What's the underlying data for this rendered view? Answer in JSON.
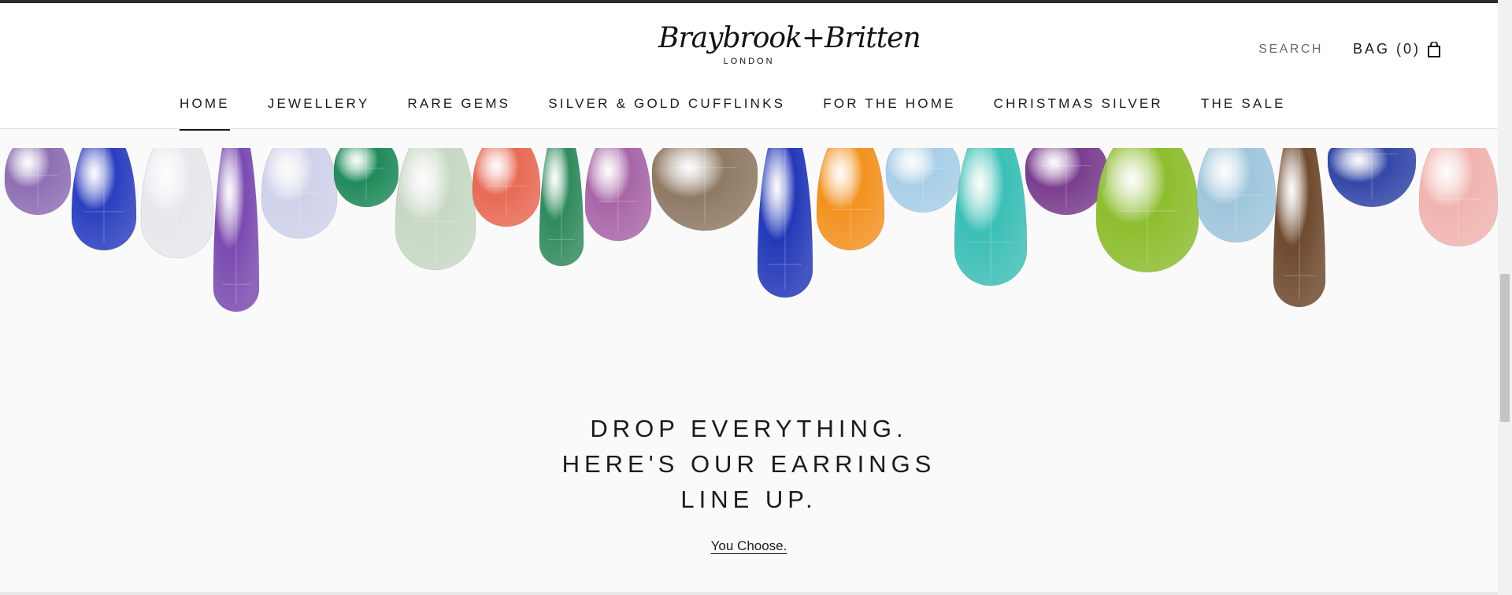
{
  "brand": {
    "logo_script": "Braybrook+Britten",
    "logo_sub": "LONDON"
  },
  "header": {
    "search_label": "SEARCH",
    "bag_label": "BAG (0)",
    "bag_icon": "shopping-bag-icon"
  },
  "nav": {
    "items": [
      {
        "label": "HOME",
        "active": true
      },
      {
        "label": "JEWELLERY"
      },
      {
        "label": "RARE GEMS"
      },
      {
        "label": "SILVER & GOLD CUFFLINKS"
      },
      {
        "label": "FOR THE HOME"
      },
      {
        "label": "CHRISTMAS SILVER"
      },
      {
        "label": "THE SALE"
      }
    ]
  },
  "hero": {
    "gem_colors": [
      "#8e6fb4",
      "#2a3fbf",
      "#e6e8ec",
      "#7b4bb0",
      "#cfd2ea",
      "#1f8a5a",
      "#c8d8c4",
      "#e86a54",
      "#2f8a5c",
      "#a866a8",
      "#8f7a64",
      "#2339b8",
      "#f39220",
      "#a8cfe8",
      "#3bbfb6",
      "#7a3e8f",
      "#8dbd2e",
      "#9fc6dc",
      "#6e4a2e",
      "#3448a8",
      "#f1b4b0"
    ]
  },
  "headline": {
    "lines": [
      "DROP EVERYTHING.",
      "HERE'S OUR EARRINGS",
      "LINE UP."
    ]
  },
  "cta": {
    "label": "You Choose."
  }
}
